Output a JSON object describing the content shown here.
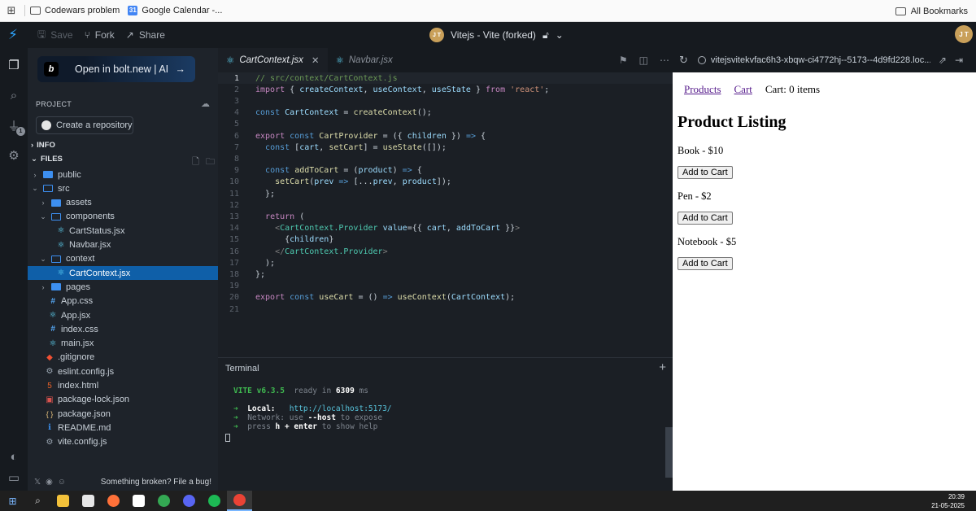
{
  "bookmarks": {
    "items": [
      {
        "label": "Codewars problem",
        "icon": "folder-icon"
      },
      {
        "label": "Google Calendar -...",
        "icon": "calendar-icon"
      }
    ],
    "all_bookmarks": "All Bookmarks"
  },
  "topbar": {
    "save": "Save",
    "fork": "Fork",
    "share": "Share",
    "project_title": "Vitejs - Vite (forked)",
    "avatar_initials": "J T"
  },
  "sidebar": {
    "open_button": "Open in bolt.new | AI",
    "project_label": "PROJECT",
    "create_repo": "Create a repository",
    "info_label": "INFO",
    "files_label": "FILES",
    "tree": [
      {
        "name": "public",
        "type": "folder",
        "depth": 1,
        "open": false
      },
      {
        "name": "src",
        "type": "folder",
        "depth": 1,
        "open": true
      },
      {
        "name": "assets",
        "type": "folder",
        "depth": 2,
        "open": false
      },
      {
        "name": "components",
        "type": "folder",
        "depth": 2,
        "open": true
      },
      {
        "name": "CartStatus.jsx",
        "type": "react",
        "depth": 3
      },
      {
        "name": "Navbar.jsx",
        "type": "react",
        "depth": 3
      },
      {
        "name": "context",
        "type": "folder",
        "depth": 2,
        "open": true
      },
      {
        "name": "CartContext.jsx",
        "type": "react",
        "depth": 3,
        "selected": true
      },
      {
        "name": "pages",
        "type": "folder",
        "depth": 2,
        "open": false
      },
      {
        "name": "App.css",
        "type": "css",
        "depth": 2
      },
      {
        "name": "App.jsx",
        "type": "react",
        "depth": 2
      },
      {
        "name": "index.css",
        "type": "css",
        "depth": 2
      },
      {
        "name": "main.jsx",
        "type": "react",
        "depth": 2
      },
      {
        "name": ".gitignore",
        "type": "git",
        "depth": 1
      },
      {
        "name": "eslint.config.js",
        "type": "gear",
        "depth": 1
      },
      {
        "name": "index.html",
        "type": "html",
        "depth": 1
      },
      {
        "name": "package-lock.json",
        "type": "npm",
        "depth": 1
      },
      {
        "name": "package.json",
        "type": "json",
        "depth": 1
      },
      {
        "name": "README.md",
        "type": "info",
        "depth": 1
      },
      {
        "name": "vite.config.js",
        "type": "gear",
        "depth": 1
      }
    ],
    "footer_text": "Something broken? File a bug!"
  },
  "editor": {
    "tabs": [
      {
        "label": "CartContext.jsx",
        "active": true
      },
      {
        "label": "Navbar.jsx",
        "active": false
      }
    ],
    "current_line": 1,
    "lines": [
      [
        [
          "c",
          "// src/context/CartContext.js"
        ]
      ],
      [
        [
          "k",
          "import"
        ],
        [
          "",
          " { "
        ],
        [
          "v",
          "createContext"
        ],
        [
          "",
          ", "
        ],
        [
          "v",
          "useContext"
        ],
        [
          "",
          ", "
        ],
        [
          "v",
          "useState"
        ],
        [
          "",
          " } "
        ],
        [
          "k",
          "from"
        ],
        [
          "",
          " "
        ],
        [
          "s",
          "'react'"
        ],
        [
          "",
          ";"
        ]
      ],
      [],
      [
        [
          "kb",
          "const"
        ],
        [
          "",
          " "
        ],
        [
          "v",
          "CartContext"
        ],
        [
          "",
          " = "
        ],
        [
          "f",
          "createContext"
        ],
        [
          "",
          "();"
        ]
      ],
      [],
      [
        [
          "k",
          "export"
        ],
        [
          "",
          " "
        ],
        [
          "kb",
          "const"
        ],
        [
          "",
          " "
        ],
        [
          "f",
          "CartProvider"
        ],
        [
          "",
          " = ({ "
        ],
        [
          "v",
          "children"
        ],
        [
          "",
          " }) "
        ],
        [
          "kb",
          "=>"
        ],
        [
          "",
          " {"
        ]
      ],
      [
        [
          "",
          "  "
        ],
        [
          "kb",
          "const"
        ],
        [
          "",
          " ["
        ],
        [
          "v",
          "cart"
        ],
        [
          "",
          ", "
        ],
        [
          "f",
          "setCart"
        ],
        [
          "",
          "] = "
        ],
        [
          "f",
          "useState"
        ],
        [
          "",
          "([]);"
        ]
      ],
      [],
      [
        [
          "",
          "  "
        ],
        [
          "kb",
          "const"
        ],
        [
          "",
          " "
        ],
        [
          "f",
          "addToCart"
        ],
        [
          "",
          " = ("
        ],
        [
          "v",
          "product"
        ],
        [
          "",
          ") "
        ],
        [
          "kb",
          "=>"
        ],
        [
          "",
          " {"
        ]
      ],
      [
        [
          "",
          "    "
        ],
        [
          "f",
          "setCart"
        ],
        [
          "",
          "("
        ],
        [
          "v",
          "prev"
        ],
        [
          "",
          " "
        ],
        [
          "kb",
          "=>"
        ],
        [
          "",
          " [..."
        ],
        [
          "v",
          "prev"
        ],
        [
          "",
          ", "
        ],
        [
          "v",
          "product"
        ],
        [
          "",
          "]);"
        ]
      ],
      [
        [
          "",
          "  };"
        ]
      ],
      [],
      [
        [
          "",
          "  "
        ],
        [
          "k",
          "return"
        ],
        [
          "",
          " ("
        ]
      ],
      [
        [
          "",
          "    "
        ],
        [
          "tag",
          "<"
        ],
        [
          "t",
          "CartContext.Provider"
        ],
        [
          "",
          " "
        ],
        [
          "v",
          "value"
        ],
        [
          "",
          "={{ "
        ],
        [
          "v",
          "cart"
        ],
        [
          "",
          ", "
        ],
        [
          "v",
          "addToCart"
        ],
        [
          "",
          " }}"
        ],
        [
          "tag",
          ">"
        ]
      ],
      [
        [
          "",
          "      {"
        ],
        [
          "v",
          "children"
        ],
        [
          "",
          "}"
        ]
      ],
      [
        [
          "",
          "    "
        ],
        [
          "tag",
          "</"
        ],
        [
          "t",
          "CartContext.Provider"
        ],
        [
          "tag",
          ">"
        ]
      ],
      [
        [
          "",
          "  );"
        ]
      ],
      [
        [
          "",
          "};"
        ]
      ],
      [],
      [
        [
          "k",
          "export"
        ],
        [
          "",
          " "
        ],
        [
          "kb",
          "const"
        ],
        [
          "",
          " "
        ],
        [
          "f",
          "useCart"
        ],
        [
          "",
          " = () "
        ],
        [
          "kb",
          "=>"
        ],
        [
          "",
          " "
        ],
        [
          "f",
          "useContext"
        ],
        [
          "",
          "("
        ],
        [
          "v",
          "CartContext"
        ],
        [
          "",
          ");"
        ]
      ],
      []
    ]
  },
  "terminal": {
    "title": "Terminal",
    "vite_name": "VITE",
    "vite_version": "v6.3.5",
    "ready_text": "ready in",
    "ready_ms": "6309",
    "ms": "ms",
    "local_label": "Local:",
    "local_url": "http://localhost:5173/",
    "network_label": "Network:",
    "network_pre": "use",
    "network_flag": "--host",
    "network_post": "to expose",
    "help_pre": "press",
    "help_key": "h + enter",
    "help_post": "to show help"
  },
  "preview": {
    "url": "vitejsvitekvfac6h3-xbqw-ci4772hj--5173--4d9fd228.loc...",
    "nav": {
      "products": "Products",
      "cart": "Cart",
      "cart_status": "Cart: 0 items"
    },
    "heading": "Product Listing",
    "products": [
      {
        "label": "Book - $10",
        "button": "Add to Cart"
      },
      {
        "label": "Pen - $2",
        "button": "Add to Cart"
      },
      {
        "label": "Notebook - $5",
        "button": "Add to Cart"
      }
    ]
  },
  "taskbar": {
    "time": "20:39",
    "date": "21-05-2025"
  },
  "colors": {
    "accent": "#0f5fa8",
    "bolt_blue": "#2ea6ff",
    "link": "#551a8b"
  }
}
